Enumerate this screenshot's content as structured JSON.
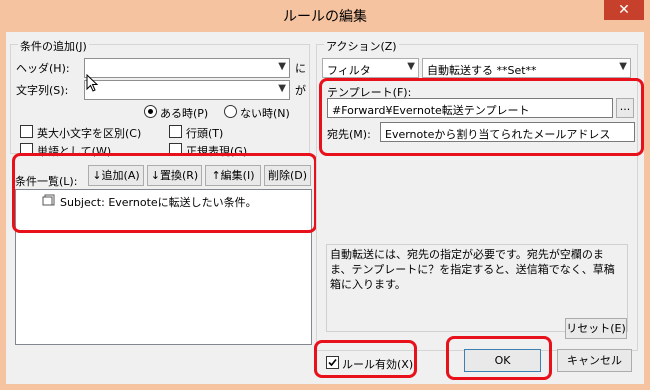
{
  "window": {
    "title": "ルールの編集",
    "close_label": "✕"
  },
  "conditions": {
    "group_label": "条件の追加(J)",
    "header_label": "ヘッダ(H):",
    "header_value": "",
    "header_suffix": "に",
    "string_label": "文字列(S):",
    "string_value": "",
    "string_suffix": "が",
    "radio_when_exists": "ある時(P)",
    "radio_when_not": "ない時(N)",
    "chk_case": "英大小文字を区別(C)",
    "chk_line_head": "行頭(T)",
    "chk_word": "単語として(W)",
    "chk_regex": "正規表現(G)"
  },
  "condition_list": {
    "label": "条件一覧(L):",
    "add": "↓追加(A)",
    "replace": "↓置換(R)",
    "edit": "↑編集(I)",
    "delete": "削除(D)",
    "items": [
      "Subject: Evernoteに転送したい条件。"
    ]
  },
  "action": {
    "group_label": "アクション(Z)",
    "type_value": "フィルタ",
    "action_value": "自動転送する **Set**",
    "template_label": "テンプレート(F):",
    "template_value": "#Forward¥Evernote転送テンプレート",
    "browse_label": "...",
    "dest_label": "宛先(M):",
    "dest_value": "Evernoteから割り当てられたメールアドレス",
    "description": "自動転送には、宛先の指定が必要です。宛先が空欄のまま、テンプレートに？を指定すると、送信箱でなく、草稿箱に入ります。",
    "reset_label": "リセット(E)"
  },
  "footer": {
    "rule_enabled": "ルール有効(X)",
    "ok": "OK",
    "cancel": "キャンセル"
  },
  "colors": {
    "highlight": "#e8101a",
    "title_bg": "#f6c3a0",
    "close_bg": "#c7402c"
  }
}
